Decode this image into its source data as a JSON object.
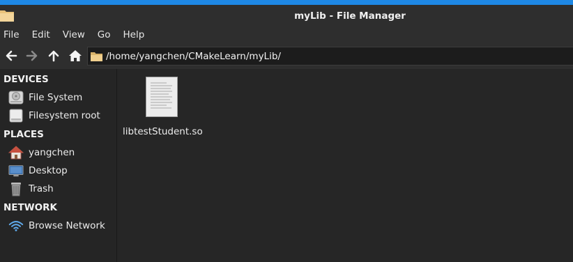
{
  "window": {
    "title": "myLib - File Manager",
    "accent_color": "#1e88e5"
  },
  "menu": {
    "items": [
      "File",
      "Edit",
      "View",
      "Go",
      "Help"
    ]
  },
  "toolbar": {
    "buttons": [
      "back-arrow-icon",
      "forward-arrow-icon",
      "up-arrow-icon",
      "home-icon"
    ],
    "location": "/home/yangchen/CMakeLearn/myLib/"
  },
  "sidebar": {
    "devices": {
      "header": "DEVICES",
      "items": [
        {
          "label": "File System",
          "icon": "drive-icon"
        },
        {
          "label": "Filesystem root",
          "icon": "drive-icon"
        }
      ]
    },
    "places": {
      "header": "PLACES",
      "items": [
        {
          "label": "yangchen",
          "icon": "home-icon"
        },
        {
          "label": "Desktop",
          "icon": "desktop-icon"
        },
        {
          "label": "Trash",
          "icon": "trash-icon"
        }
      ]
    },
    "network": {
      "header": "NETWORK",
      "items": [
        {
          "label": "Browse Network",
          "icon": "wifi-icon"
        }
      ]
    }
  },
  "files": [
    {
      "name": "libtestStudent.so",
      "icon": "document-icon"
    }
  ]
}
